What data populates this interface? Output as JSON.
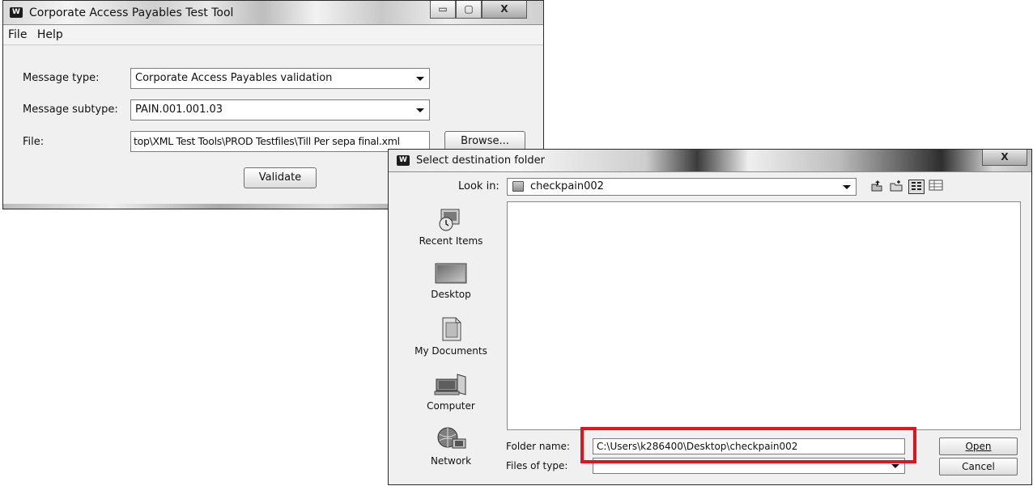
{
  "main_window": {
    "title": "Corporate Access Payables Test Tool",
    "icon": "app-logo-icon",
    "caption_buttons": {
      "minimize": "▭",
      "maximize": "▢",
      "close": "X"
    },
    "menu": [
      "File",
      "Help"
    ],
    "form": {
      "message_type_label": "Message type:",
      "message_type_value": "Corporate Access Payables validation",
      "message_subtype_label": "Message subtype:",
      "message_subtype_value": "PAIN.001.001.03",
      "file_label": "File:",
      "file_value": "top\\XML Test Tools\\PROD Testfiles\\Till Per sepa final.xml",
      "browse_button": "Browse...",
      "validate_button": "Validate"
    }
  },
  "dialog": {
    "title": "Select destination folder",
    "close_button": "X",
    "look_in_label": "Look in:",
    "look_in_value": "checkpain002",
    "toolbar_icons": [
      "up-folder-icon",
      "new-folder-icon",
      "list-view-icon",
      "details-view-icon"
    ],
    "places": [
      {
        "label": "Recent Items",
        "icon": "recent-items-icon"
      },
      {
        "label": "Desktop",
        "icon": "desktop-icon"
      },
      {
        "label": "My Documents",
        "icon": "my-documents-icon"
      },
      {
        "label": "Computer",
        "icon": "computer-icon"
      },
      {
        "label": "Network",
        "icon": "network-icon"
      }
    ],
    "folder_name_label": "Folder name:",
    "folder_name_value": "C:\\Users\\k286400\\Desktop\\checkpain002",
    "files_of_type_label": "Files of type:",
    "files_of_type_value": "",
    "open_button": "Open",
    "cancel_button": "Cancel"
  },
  "colors": {
    "highlight": "#e0141c"
  }
}
